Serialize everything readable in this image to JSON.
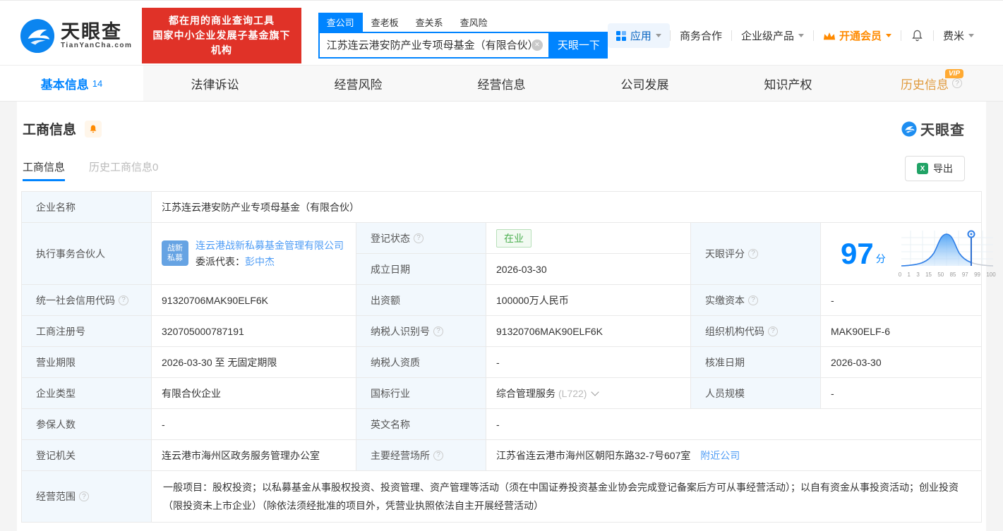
{
  "colors": {
    "accent": "#0084ff",
    "vip_orange": "#ff8a00",
    "status_green": "#4caf50",
    "promo_red": "#e03228"
  },
  "header": {
    "logo": {
      "name": "天眼查",
      "domain": "TianYanCha.com"
    },
    "promo": {
      "line1": "都在用的商业查询工具",
      "line2": "国家中小企业发展子基金旗下机构"
    },
    "search": {
      "tabs": [
        {
          "label": "查公司"
        },
        {
          "label": "查老板"
        },
        {
          "label": "查关系"
        },
        {
          "label": "查风险"
        }
      ],
      "value": "江苏连云港安防产业专项母基金（有限合伙）",
      "button": "天眼一下"
    },
    "menu": {
      "apps": "应用",
      "cooperation": "商务合作",
      "enterprise": "企业级产品",
      "vip": "开通会员",
      "user": "费米"
    }
  },
  "nav": {
    "tabs": [
      {
        "label": "基本信息",
        "count": "14"
      },
      {
        "label": "法律诉讼"
      },
      {
        "label": "经营风险"
      },
      {
        "label": "经营信息"
      },
      {
        "label": "公司发展"
      },
      {
        "label": "知识产权"
      },
      {
        "label": "历史信息",
        "badge": "VIP"
      }
    ]
  },
  "section": {
    "title": "工商信息",
    "watermark": "天眼查",
    "subtabs": [
      {
        "label": "工商信息"
      },
      {
        "label": "历史工商信息0"
      }
    ],
    "export": "导出"
  },
  "info": {
    "company_name": {
      "label": "企业名称",
      "value": "江苏连云港安防产业专项母基金（有限合伙）"
    },
    "partner": {
      "label": "执行事务合伙人",
      "avatar": "战新私募",
      "company": "连云港战新私募基金管理有限公司",
      "rep_label": "委派代表：",
      "rep_name": "彭中杰"
    },
    "reg_status": {
      "label": "登记状态",
      "value": "在业"
    },
    "est_date": {
      "label": "成立日期",
      "value": "2026-03-30"
    },
    "score": {
      "label": "天眼评分",
      "value": "97",
      "unit": "分",
      "axis": [
        "0",
        "1",
        "3",
        "15",
        "50",
        "85",
        "97",
        "99",
        "100"
      ]
    },
    "credit_code": {
      "label": "统一社会信用代码",
      "value": "91320706MAK90ELF6K"
    },
    "contribution": {
      "label": "出资额",
      "value": "100000万人民币"
    },
    "paid_capital": {
      "label": "实缴资本",
      "value": "-"
    },
    "reg_no": {
      "label": "工商注册号",
      "value": "320705000787191"
    },
    "taxpayer_id": {
      "label": "纳税人识别号",
      "value": "91320706MAK90ELF6K"
    },
    "org_code": {
      "label": "组织机构代码",
      "value": "MAK90ELF-6"
    },
    "term": {
      "label": "营业期限",
      "value": "2026-03-30 至 无固定期限"
    },
    "taxpayer_qual": {
      "label": "纳税人资质",
      "value": "-"
    },
    "approval_date": {
      "label": "核准日期",
      "value": "2026-03-30"
    },
    "company_type": {
      "label": "企业类型",
      "value": "有限合伙企业"
    },
    "industry": {
      "label": "国标行业",
      "value": "综合管理服务",
      "code": "(L722)"
    },
    "staff_size": {
      "label": "人员规模",
      "value": "-"
    },
    "insured": {
      "label": "参保人数",
      "value": "-"
    },
    "english_name": {
      "label": "英文名称",
      "value": "-"
    },
    "reg_authority": {
      "label": "登记机关",
      "value": "连云港市海州区政务服务管理办公室"
    },
    "place": {
      "label": "主要经营场所",
      "value": "江苏省连云港市海州区朝阳东路32-7号607室",
      "link": "附近公司"
    },
    "scope": {
      "label": "经营范围",
      "value": "一般项目：股权投资；以私募基金从事股权投资、投资管理、资产管理等活动（须在中国证券投资基金业协会完成登记备案后方可从事经营活动）；以自有资金从事投资活动；创业投资（限投资未上市企业）（除依法须经批准的项目外，凭营业执照依法自主开展经营活动）"
    }
  }
}
